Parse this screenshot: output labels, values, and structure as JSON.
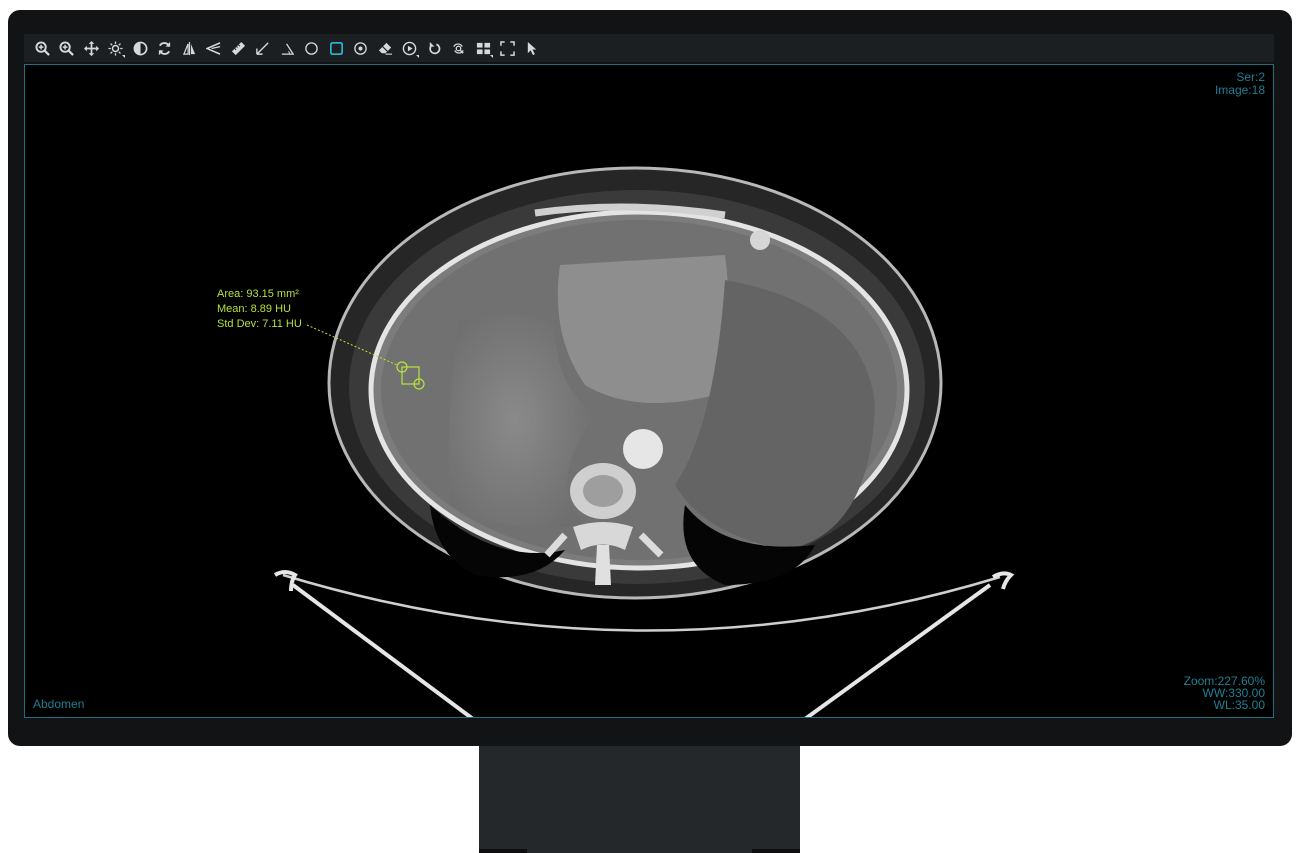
{
  "toolbar": {
    "tools": [
      {
        "name": "zoom-in-tool",
        "icon": "zoom-in-icon"
      },
      {
        "name": "zoom-tool",
        "icon": "zoom-icon"
      },
      {
        "name": "pan-tool",
        "icon": "move-icon"
      },
      {
        "name": "brightness-tool",
        "icon": "brightness-icon"
      },
      {
        "name": "invert-tool",
        "icon": "contrast-icon"
      },
      {
        "name": "reset-tool",
        "icon": "refresh-icon"
      },
      {
        "name": "flip-tool",
        "icon": "flip-icon"
      },
      {
        "name": "angle-tool",
        "icon": "angle-icon"
      },
      {
        "name": "length-tool",
        "icon": "ruler-icon"
      },
      {
        "name": "arrow-tool",
        "icon": "arrow-icon"
      },
      {
        "name": "cobb-angle-tool",
        "icon": "triangle-icon"
      },
      {
        "name": "ellipse-roi-tool",
        "icon": "circle-icon"
      },
      {
        "name": "rectangle-roi-tool",
        "icon": "square-icon",
        "active": true
      },
      {
        "name": "probe-tool",
        "icon": "target-icon"
      },
      {
        "name": "eraser-tool",
        "icon": "eraser-icon"
      },
      {
        "name": "cine-tool",
        "icon": "play-icon"
      },
      {
        "name": "rotate-tool",
        "icon": "rotate-icon"
      },
      {
        "name": "magnify-tool",
        "icon": "magnify-icon"
      },
      {
        "name": "layout-tool",
        "icon": "grid-icon"
      },
      {
        "name": "fullscreen-tool",
        "icon": "fullscreen-icon"
      },
      {
        "name": "pointer-tool",
        "icon": "cursor-icon"
      }
    ],
    "icon_color": "#d8d8d8",
    "active_color": "#2ec7e8"
  },
  "viewport": {
    "series": "Ser:2",
    "image": "Image:18",
    "zoom": "Zoom:227.60%",
    "ww": "WW:330.00",
    "wl": "WL:35.00",
    "body_part": "Abdomen",
    "overlay_color": "#1f7f93"
  },
  "measurement": {
    "area": "Area: 93.15 mm²",
    "mean": "Mean: 8.89 HU",
    "std_dev": "Std Dev: 7.11 HU",
    "color": "#b7e33a"
  }
}
